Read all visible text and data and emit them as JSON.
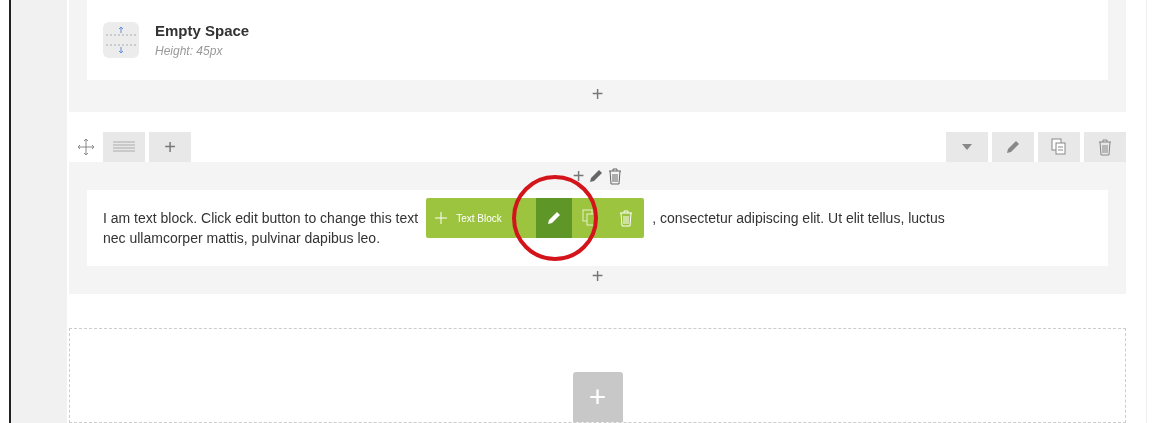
{
  "empty_space": {
    "title": "Empty Space",
    "subtitle": "Height: 45px",
    "add_symbol": "+"
  },
  "row": {
    "add_symbol": "+",
    "column_controls": {
      "add_symbol": "+"
    },
    "text_block": {
      "line1_left": "I am text block. Click edit button to change this text",
      "line1_right": ", consectetur adipiscing elit. Ut elit tellus, luctus",
      "line2": "nec ullamcorper mattis, pulvinar dapibus leo."
    },
    "element_toolbar": {
      "label": "Text Block",
      "highlighted": true
    },
    "after_add_symbol": "+"
  },
  "new_row_add_symbol": "+"
}
